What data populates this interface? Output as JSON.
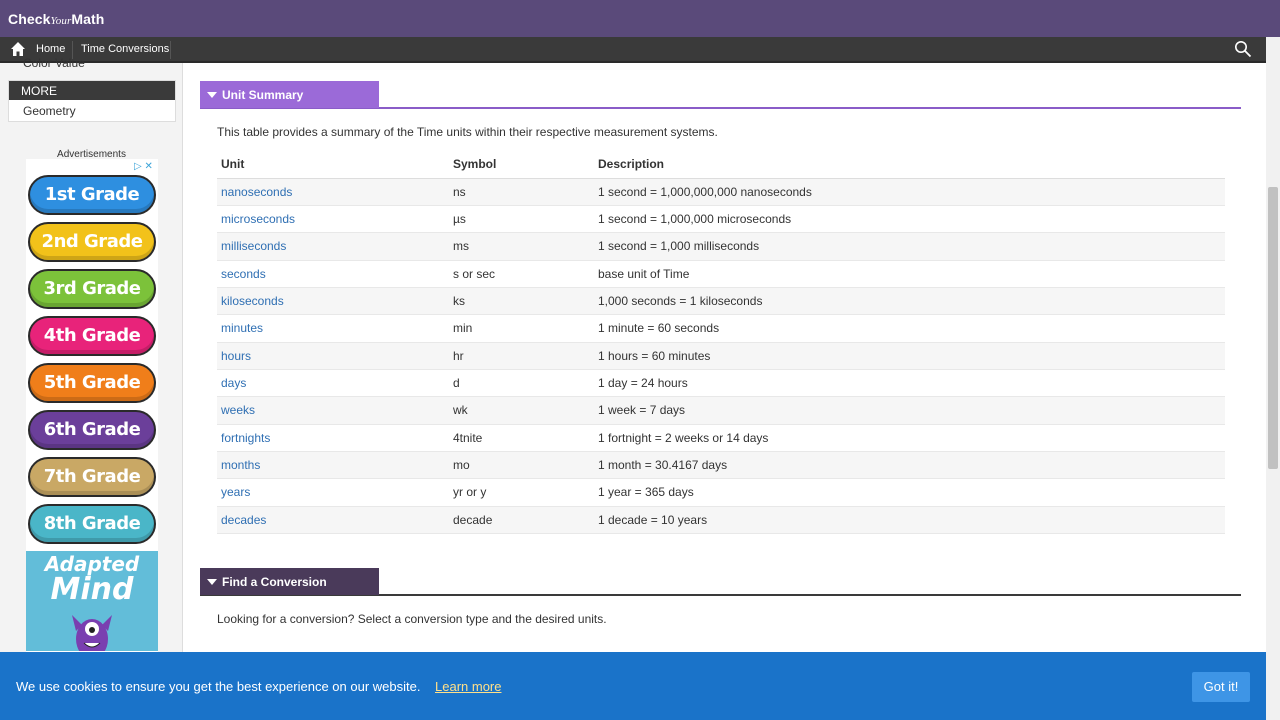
{
  "brand": {
    "logo_part1": "Check",
    "logo_part2": "Your",
    "logo_part3": "Math"
  },
  "nav": {
    "home_label": "Home",
    "current_label": "Time Conversions",
    "icons": [
      "home-icon",
      "search-icon"
    ]
  },
  "sidebar": {
    "cut_item": "Color Value",
    "section_label": "MORE",
    "item_geometry": "Geometry",
    "ads_label": "Advertisements",
    "ad_grades": [
      "1st Grade",
      "2nd Grade",
      "3rd Grade",
      "4th Grade",
      "5th Grade",
      "6th Grade",
      "7th Grade",
      "8th Grade"
    ],
    "ad_grade_colors": [
      "#2e8fe0",
      "#f2c21a",
      "#7cc23a",
      "#e8237a",
      "#f07e1a",
      "#6b3f9a",
      "#c9a865",
      "#4ab6c8"
    ],
    "adapted_line1": "Adapted",
    "adapted_line2": "Mind"
  },
  "unit_summary": {
    "title": "Unit Summary",
    "intro": "This table provides a summary of the Time units within their respective measurement systems.",
    "headers": [
      "Unit",
      "Symbol",
      "Description"
    ],
    "rows": [
      {
        "unit": "nanoseconds",
        "symbol": "ns",
        "description": "1 second = 1,000,000,000 nanoseconds"
      },
      {
        "unit": "microseconds",
        "symbol": "µs",
        "description": "1 second = 1,000,000 microseconds"
      },
      {
        "unit": "milliseconds",
        "symbol": "ms",
        "description": "1 second = 1,000 milliseconds"
      },
      {
        "unit": "seconds",
        "symbol": "s or sec",
        "description": "base unit of Time"
      },
      {
        "unit": "kiloseconds",
        "symbol": "ks",
        "description": "1,000 seconds = 1 kiloseconds"
      },
      {
        "unit": "minutes",
        "symbol": "min",
        "description": "1 minute = 60 seconds"
      },
      {
        "unit": "hours",
        "symbol": "hr",
        "description": "1 hours = 60 minutes"
      },
      {
        "unit": "days",
        "symbol": "d",
        "description": "1 day = 24 hours"
      },
      {
        "unit": "weeks",
        "symbol": "wk",
        "description": "1 week = 7 days"
      },
      {
        "unit": "fortnights",
        "symbol": "4tnite",
        "description": "1 fortnight = 2 weeks or 14 days"
      },
      {
        "unit": "months",
        "symbol": "mo",
        "description": "1 month = 30.4167 days"
      },
      {
        "unit": "years",
        "symbol": "yr or y",
        "description": "1 year = 365 days"
      },
      {
        "unit": "decades",
        "symbol": "decade",
        "description": "1 decade = 10 years"
      }
    ]
  },
  "find_conversion": {
    "title": "Find a Conversion",
    "intro": "Looking for a conversion? Select a conversion type and the desired units."
  },
  "cookie": {
    "message": "We use cookies to ensure you get the best experience on our website.",
    "link": "Learn more",
    "button": "Got it!"
  },
  "colors": {
    "topbar": "#5a4a7a",
    "navbar": "#3a3a3a",
    "summary_tab": "#9b6ad8",
    "find_tab": "#4a3a5a",
    "link": "#2f6fb3",
    "cookie_bar": "#1a73c9"
  }
}
